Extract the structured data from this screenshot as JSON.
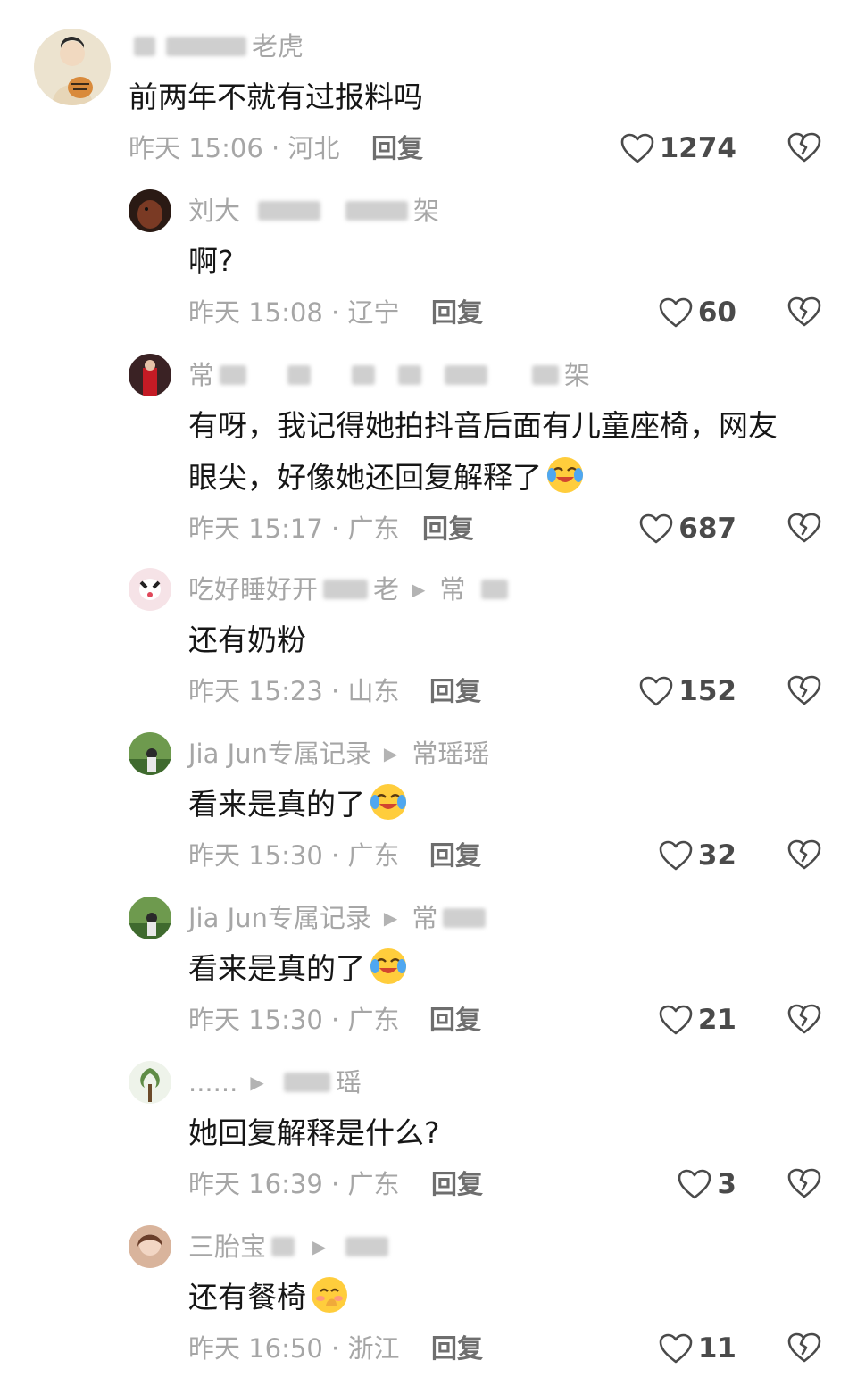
{
  "comments": [
    {
      "name": "老虎",
      "text": "前两年不就有过报料吗",
      "time": "昨天 15:06 · 河北",
      "reply": "回复",
      "likes": "1274",
      "avatar_color": "#d8c9a6"
    },
    {
      "name": "刘大",
      "name_tail": "架",
      "text": "啊?",
      "time": "昨天 15:08 · 辽宁",
      "reply": "回复",
      "likes": "60",
      "avatar_color": "#6b2a1c"
    },
    {
      "name": "常",
      "name_tail": "架",
      "text": "有呀，我记得她拍抖音后面有儿童座椅，网友",
      "text2": "眼尖，好像她还回复解释了",
      "time": "昨天 15:17 · 广东",
      "reply": "回复",
      "likes": "687",
      "avatar_color": "#b0161f"
    },
    {
      "name": "吃好睡好开",
      "name_mid": "老",
      "reply_to": "常",
      "text": "还有奶粉",
      "time": "昨天 15:23 · 山东",
      "reply": "回复",
      "likes": "152",
      "avatar_color": "#f3d7dc"
    },
    {
      "name": "Jia Jun专属记录",
      "reply_to": "常瑶瑶",
      "text": "看来是真的了",
      "time": "昨天 15:30 · 广东",
      "reply": "回复",
      "likes": "32",
      "avatar_color": "#4f7a3a"
    },
    {
      "name": "Jia Jun专属记录",
      "reply_to": "常",
      "text": "看来是真的了",
      "time": "昨天 15:30 · 广东",
      "reply": "回复",
      "likes": "21",
      "avatar_color": "#4f7a3a"
    },
    {
      "name": "......",
      "reply_to": "瑶",
      "text": "她回复解释是什么?",
      "time": "昨天 16:39 · 广东",
      "reply": "回复",
      "likes": "3",
      "avatar_color": "#7fa06a"
    },
    {
      "name": "三胎宝",
      "text": "还有餐椅",
      "time": "昨天 16:50 · 浙江",
      "reply": "回复",
      "likes": "11",
      "avatar_color": "#e9c8b6"
    }
  ],
  "icons": {
    "like": "heart-outline-icon",
    "dislike": "broken-heart-icon",
    "reply_arrow": "triangle-right-icon"
  }
}
